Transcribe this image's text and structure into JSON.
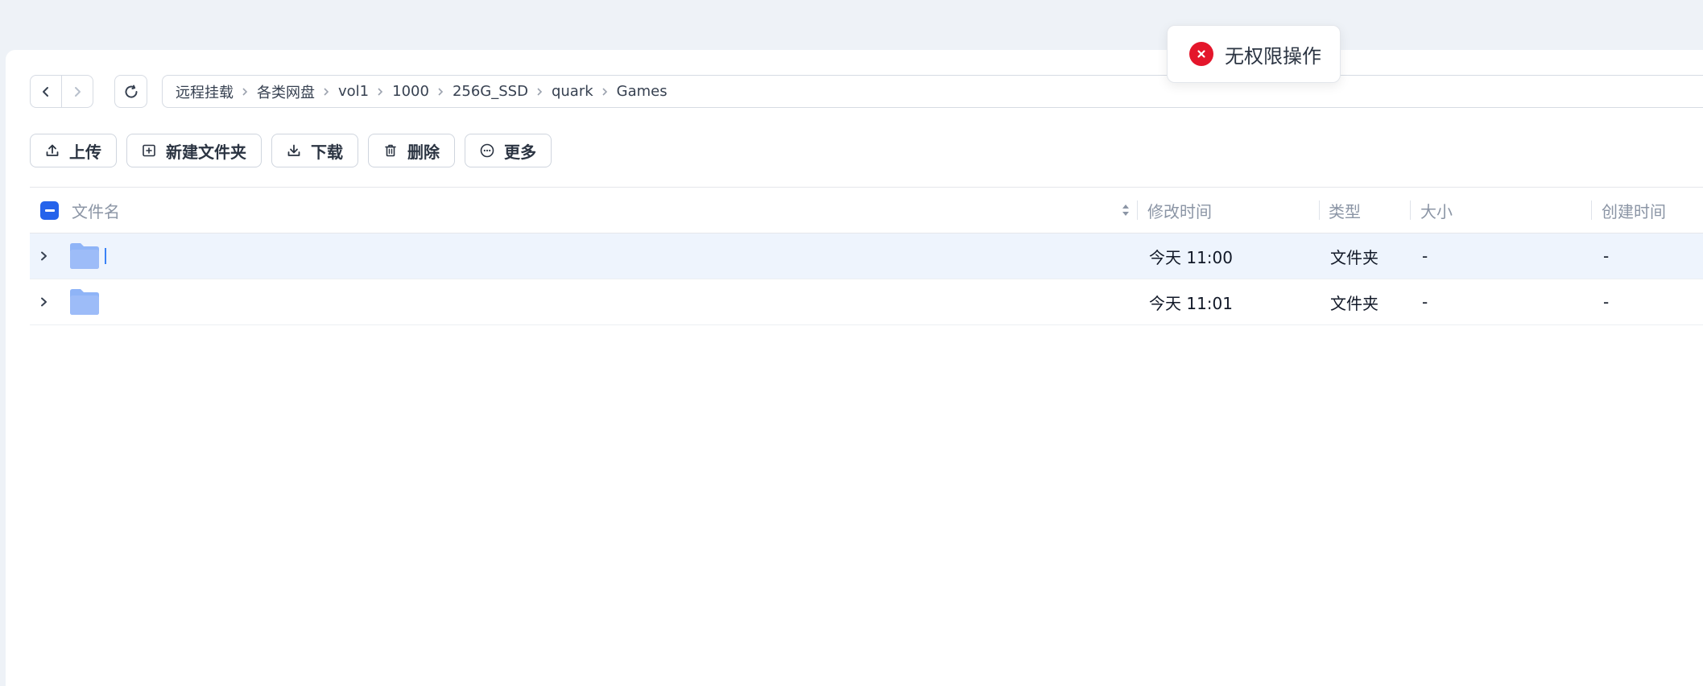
{
  "breadcrumb": [
    "远程挂载",
    "各类网盘",
    "vol1",
    "1000",
    "256G_SSD",
    "quark",
    "Games"
  ],
  "toolbar": {
    "upload": "上传",
    "new_folder": "新建文件夹",
    "download": "下载",
    "delete": "删除",
    "more": "更多"
  },
  "table": {
    "columns": [
      "文件名",
      "修改时间",
      "类型",
      "大小",
      "创建时间"
    ],
    "rows": [
      {
        "name": "",
        "modified": "今天 11:00",
        "type": "文件夹",
        "size": "-",
        "created": "-"
      },
      {
        "name": "",
        "modified": "今天 11:01",
        "type": "文件夹",
        "size": "-",
        "created": "-"
      }
    ]
  },
  "toast": {
    "message": "无权限操作"
  },
  "colors": {
    "accent": "#2563eb",
    "error": "#e4162b",
    "folder": "#8fb4f7",
    "selected_row": "#eef4fd"
  },
  "icons": {
    "back": "chevron-left-icon",
    "forward": "chevron-right-icon",
    "refresh": "refresh-icon",
    "upload": "upload-icon",
    "new_folder": "folder-plus-icon",
    "download": "download-icon",
    "delete": "trash-icon",
    "more": "more-icon",
    "folder": "folder-icon",
    "error": "close-circle-icon"
  }
}
